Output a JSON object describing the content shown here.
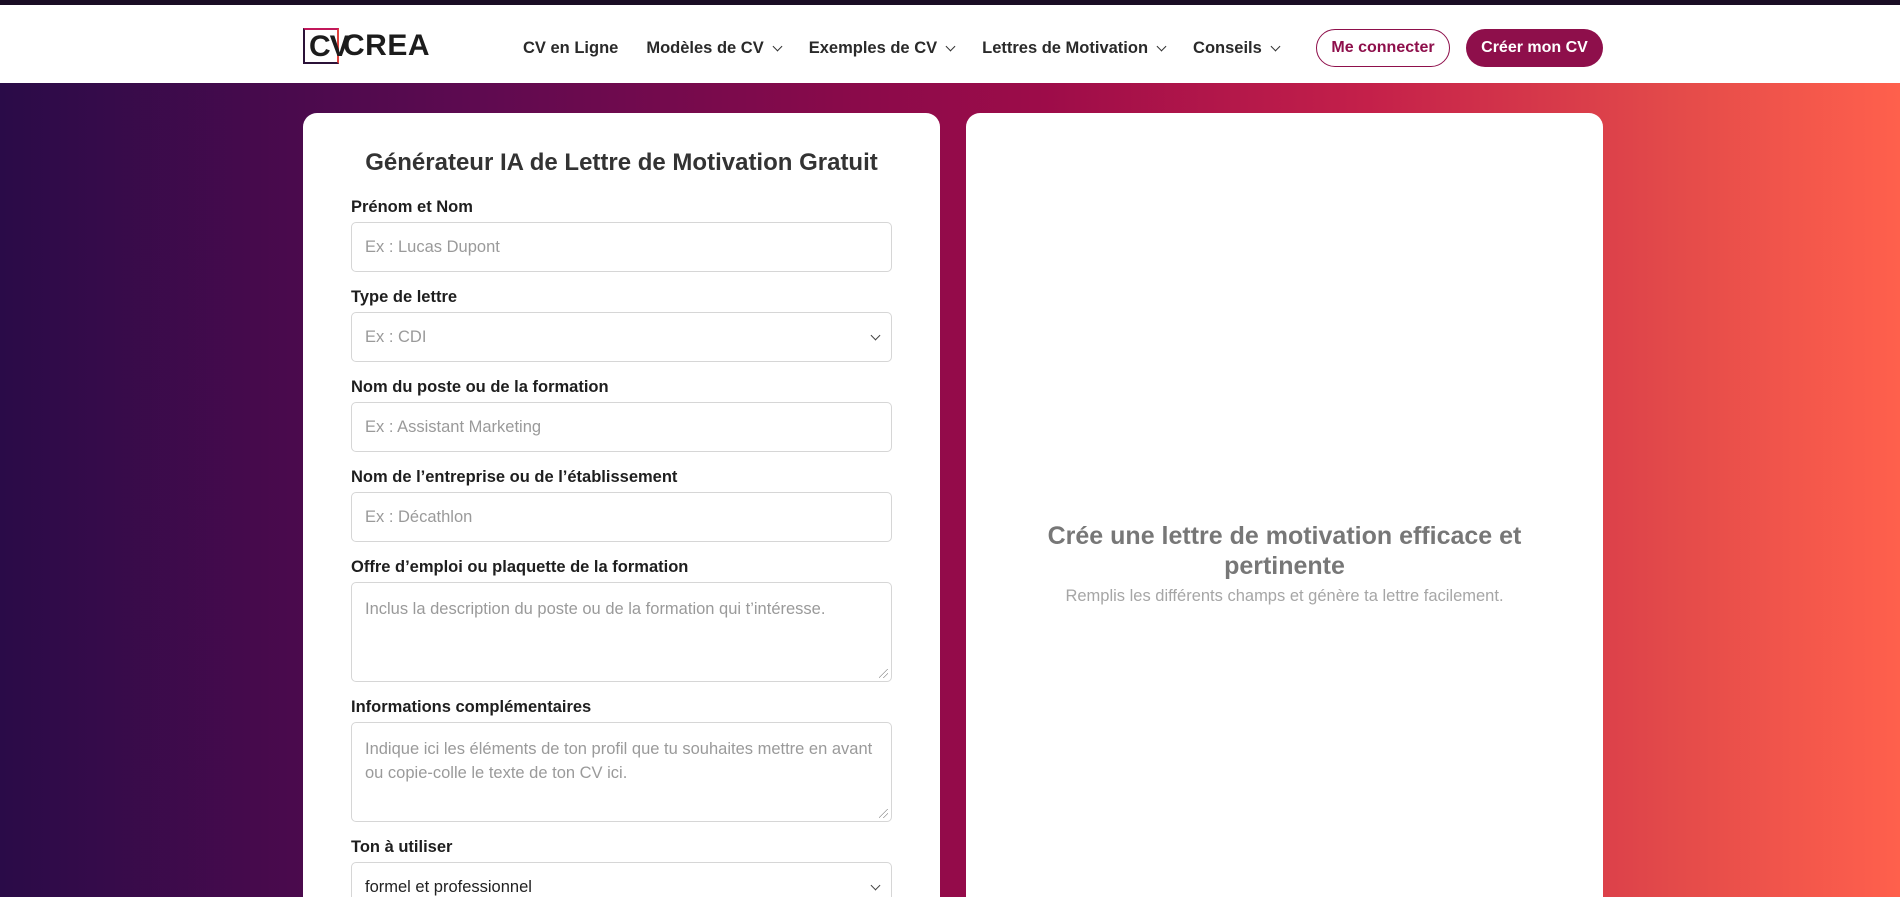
{
  "brand": {
    "logo_letters": "CV",
    "logo_rest": "CREA"
  },
  "nav": {
    "items": [
      {
        "label": "CV en Ligne",
        "dropdown": false
      },
      {
        "label": "Modèles de CV",
        "dropdown": true
      },
      {
        "label": "Exemples de CV",
        "dropdown": true
      },
      {
        "label": "Lettres de Motivation",
        "dropdown": true
      },
      {
        "label": "Conseils",
        "dropdown": true
      }
    ],
    "login_label": "Me connecter",
    "create_label": "Créer mon CV"
  },
  "colors": {
    "brand": "#8e0f4b",
    "gradient_start": "#2a0b48",
    "gradient_end": "#ff604c"
  },
  "form": {
    "title": "Générateur IA de Lettre de Motivation Gratuit",
    "fields": {
      "name": {
        "label": "Prénom et Nom",
        "placeholder": "Ex : Lucas Dupont"
      },
      "letter_type": {
        "label": "Type de lettre",
        "value": "Ex : CDI"
      },
      "position": {
        "label": "Nom du poste ou de la formation",
        "placeholder": "Ex : Assistant Marketing"
      },
      "company": {
        "label": "Nom de l’entreprise ou de l’établissement",
        "placeholder": "Ex : Décathlon"
      },
      "offer": {
        "label": "Offre d’emploi ou plaquette de la formation",
        "placeholder": "Inclus la description du poste ou de la formation qui t’intéresse."
      },
      "extra": {
        "label": "Informations complémentaires",
        "placeholder": "Indique ici les éléments de ton profil que tu souhaites mettre en avant ou copie-colle le texte de ton CV ici."
      },
      "tone": {
        "label": "Ton à utiliser",
        "value": "formel et professionnel"
      }
    }
  },
  "preview": {
    "title": "Crée une lettre de motivation efficace et pertinente",
    "subtitle": "Remplis les différents champs et génère ta lettre facilement."
  }
}
